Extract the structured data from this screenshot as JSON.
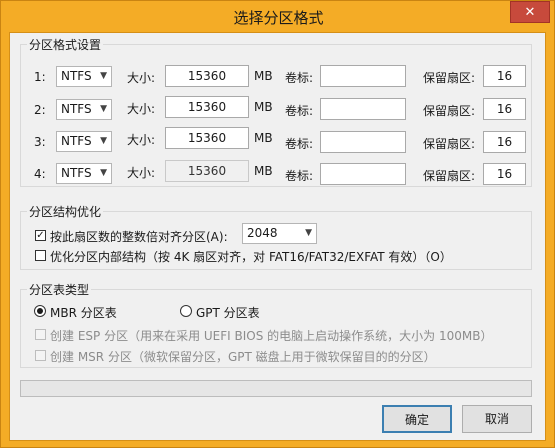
{
  "window": {
    "title": "选择分区格式",
    "close_glyph": "✕"
  },
  "partition_settings": {
    "group_label": "分区格式设置",
    "size_label": "大小:",
    "unit": "MB",
    "volume_label": "卷标:",
    "reserved_label": "保留扇区:",
    "rows": [
      {
        "index": "1:",
        "fs": "NTFS",
        "size": "15360",
        "volume": "",
        "reserved": "16",
        "size_disabled": false
      },
      {
        "index": "2:",
        "fs": "NTFS",
        "size": "15360",
        "volume": "",
        "reserved": "16",
        "size_disabled": false
      },
      {
        "index": "3:",
        "fs": "NTFS",
        "size": "15360",
        "volume": "",
        "reserved": "16",
        "size_disabled": false
      },
      {
        "index": "4:",
        "fs": "NTFS",
        "size": "15360",
        "volume": "",
        "reserved": "16",
        "size_disabled": true
      }
    ]
  },
  "structure": {
    "group_label": "分区结构优化",
    "align_label": "按此扇区数的整数倍对齐分区(A):",
    "align_checked": true,
    "align_value": "2048",
    "optimize_label": "优化分区内部结构（按 4K 扇区对齐，对 FAT16/FAT32/EXFAT 有效）（O）",
    "optimize_checked": false
  },
  "table_type": {
    "group_label": "分区表类型",
    "mbr_label": "MBR 分区表",
    "gpt_label": "GPT 分区表",
    "selected": "MBR",
    "esp_label": "创建 ESP 分区（用来在采用 UEFI BIOS 的电脑上启动操作系统，大小为 100MB）",
    "msr_label": "创建 MSR 分区（微软保留分区，GPT 磁盘上用于微软保留目的的分区）"
  },
  "buttons": {
    "ok": "确定",
    "cancel": "取消"
  }
}
